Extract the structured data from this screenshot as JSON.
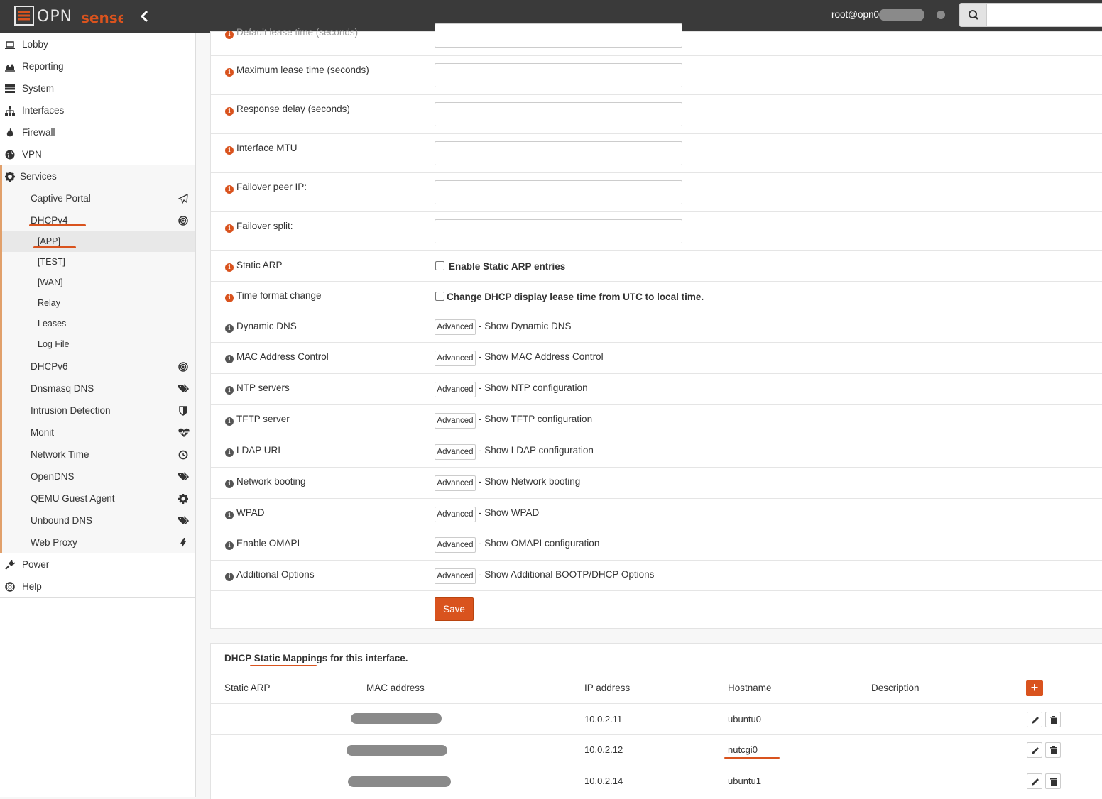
{
  "header": {
    "brand": "OPNsense",
    "user": "root@opn0",
    "search_placeholder": ""
  },
  "sidebar": {
    "items": [
      {
        "label": "Lobby",
        "icon": "laptop-icon"
      },
      {
        "label": "Reporting",
        "icon": "area-chart-icon"
      },
      {
        "label": "System",
        "icon": "server-icon"
      },
      {
        "label": "Interfaces",
        "icon": "sitemap-icon"
      },
      {
        "label": "Firewall",
        "icon": "fire-icon"
      },
      {
        "label": "VPN",
        "icon": "globe-icon"
      },
      {
        "label": "Services",
        "icon": "cog-icon"
      }
    ],
    "services": [
      {
        "label": "Captive Portal",
        "icon": "paper-plane-icon"
      },
      {
        "label": "DHCPv4",
        "icon": "bullseye-icon"
      },
      {
        "label": "DHCPv6",
        "icon": "bullseye-icon"
      },
      {
        "label": "Dnsmasq DNS",
        "icon": "tags-icon"
      },
      {
        "label": "Intrusion Detection",
        "icon": "shield-icon"
      },
      {
        "label": "Monit",
        "icon": "heartbeat-icon"
      },
      {
        "label": "Network Time",
        "icon": "clock-icon"
      },
      {
        "label": "OpenDNS",
        "icon": "tags-icon"
      },
      {
        "label": "QEMU Guest Agent",
        "icon": "cog-icon"
      },
      {
        "label": "Unbound DNS",
        "icon": "tags-icon"
      },
      {
        "label": "Web Proxy",
        "icon": "bolt-icon"
      }
    ],
    "dhcpv4_sub": [
      "[APP]",
      "[TEST]",
      "[WAN]",
      "Relay",
      "Leases",
      "Log File"
    ],
    "bottom": [
      {
        "label": "Power",
        "icon": "plug-icon"
      },
      {
        "label": "Help",
        "icon": "life-ring-icon"
      }
    ]
  },
  "form": {
    "partial_label": "Default lease time (seconds)",
    "text_fields": [
      "Maximum lease time (seconds)",
      "Response delay (seconds)",
      "Interface MTU",
      "Failover peer IP:",
      "Failover split:"
    ],
    "static_arp": {
      "label": "Static ARP",
      "checkbox": "Enable Static ARP entries"
    },
    "time_format": {
      "label": "Time format change",
      "checkbox": "Change DHCP display lease time from UTC to local time."
    },
    "advanced_button": "Advanced",
    "advanced_rows": [
      {
        "label": "Dynamic DNS",
        "desc": "- Show Dynamic DNS"
      },
      {
        "label": "MAC Address Control",
        "desc": "- Show MAC Address Control"
      },
      {
        "label": "NTP servers",
        "desc": "- Show NTP configuration"
      },
      {
        "label": "TFTP server",
        "desc": "- Show TFTP configuration"
      },
      {
        "label": "LDAP URI",
        "desc": "- Show LDAP configuration"
      },
      {
        "label": "Network booting",
        "desc": "- Show Network booting"
      },
      {
        "label": "WPAD",
        "desc": "- Show WPAD"
      },
      {
        "label": "Enable OMAPI",
        "desc": "- Show OMAPI configuration"
      },
      {
        "label": "Additional Options",
        "desc": "- Show Additional BOOTP/DHCP Options"
      }
    ],
    "save_label": "Save"
  },
  "mappings": {
    "title": "DHCP Static Mappings for this interface.",
    "columns": [
      "Static ARP",
      "MAC address",
      "IP address",
      "Hostname",
      "Description"
    ],
    "add_label": "+",
    "rows": [
      {
        "static_arp": "",
        "mac": "",
        "ip": "10.0.2.11",
        "hostname": "ubuntu0",
        "description": ""
      },
      {
        "static_arp": "",
        "mac": "",
        "ip": "10.0.2.12",
        "hostname": "nutcgi0",
        "description": ""
      },
      {
        "static_arp": "",
        "mac": "",
        "ip": "10.0.2.14",
        "hostname": "ubuntu1",
        "description": ""
      }
    ]
  },
  "colors": {
    "accent": "#d9531e",
    "topbar": "#3a3a3a"
  }
}
